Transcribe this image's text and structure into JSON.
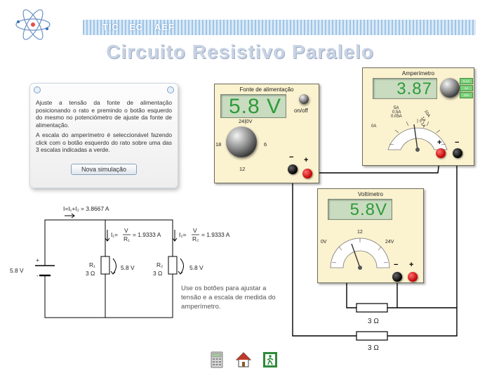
{
  "header": {
    "banner": [
      "TIC",
      "EC",
      "AEF"
    ],
    "banner_right": "",
    "title": "Circuito Resistivo Paralelo"
  },
  "instructions": {
    "p1": "Ajuste a tensão da fonte de alimentação posicionando o rato e premindo o botão esquerdo do mesmo no potenciómetro de ajuste da fonte de alimentação.",
    "p2": "A escala do amperímetro é seleccionável fazendo click com o botão esquerdo do rato sobre uma das 3 escalas indicadas a verde.",
    "new_sim_button": "Nova simulação"
  },
  "power_supply": {
    "label": "Fonte de alimentação",
    "display": "5.8 V",
    "switch_label": "on/off",
    "dial": {
      "top": "24|0V",
      "right": "6",
      "left": "18",
      "bottom": "12"
    },
    "value_volts": 5.8,
    "minus": "−",
    "plus": "+"
  },
  "ammeter": {
    "label": "Amperímetro",
    "display": "3.87",
    "scales": [
      "0.1A",
      "1A",
      "10A"
    ],
    "dial_labels": [
      "5A",
      "0.5A",
      "0.05A",
      "0A",
      "10A",
      "1A",
      "0.1A"
    ],
    "minus": "−",
    "plus": "+"
  },
  "voltmeter": {
    "label": "Voltímetro",
    "display": "5.8V",
    "dial": {
      "left": "0V",
      "mid": "12",
      "right": "24V"
    },
    "minus": "−",
    "plus": "+"
  },
  "loads": {
    "r_top": "3 Ω",
    "r_bottom": "3 Ω"
  },
  "circuit": {
    "total_current": "I=I₁+I₂ = 3.8667 A",
    "i1_prefix": "I₁=",
    "i1_num": "V",
    "i1_den": "R₁",
    "i1_value": "= 1.9333 A",
    "i2_prefix": "I₂=",
    "i2_num": "V",
    "i2_den": "R₂",
    "i2_value": "= 1.9333 A",
    "source_voltage": "5.8 V",
    "plus": "+",
    "minus": "-",
    "r1_name": "R₁",
    "r1_value": "3 Ω",
    "r2_name": "R₂",
    "r2_value": "3 Ω",
    "v1": "5.8 V",
    "v2": "5.8 V"
  },
  "note": "Use os botões para ajustar a tensão e a escala de medida do amperímetro.",
  "footer": {
    "icons": [
      "calculator-icon",
      "home-icon",
      "exit-icon"
    ]
  },
  "colors": {
    "panel_bg": "#fbf2cf",
    "lcd_bg": "#c9dcc0",
    "lcd_text": "#2f9a3a",
    "banner": "#9fc4e6",
    "scale_green": "#7bd07a"
  }
}
